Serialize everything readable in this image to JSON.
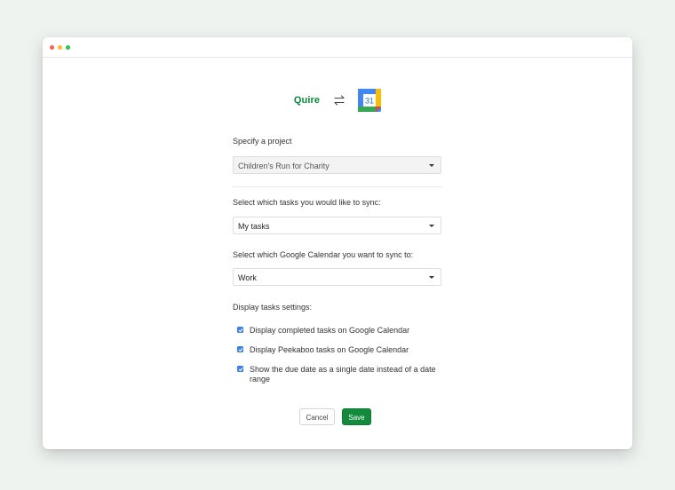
{
  "window": {
    "controls": [
      {
        "name": "close",
        "color": "#ff5f57"
      },
      {
        "name": "minimize",
        "color": "#febc2e"
      },
      {
        "name": "maximize",
        "color": "#28c840"
      }
    ]
  },
  "header": {
    "app_name": "Quire",
    "sync_icon": "swap-arrows-icon",
    "calendar_icon": "google-calendar-icon",
    "calendar_day": "31"
  },
  "form": {
    "project_label": "Specify a project",
    "project_value": "Children's Run for Charity",
    "tasks_label": "Select which tasks you would like to sync:",
    "tasks_value": "My tasks",
    "calendar_label": "Select which Google Calendar you want to sync to:",
    "calendar_value": "Work",
    "display_label": "Display tasks settings:",
    "options": [
      {
        "label": "Display completed tasks on Google Calendar",
        "checked": true
      },
      {
        "label": "Display Peekaboo tasks on Google Calendar",
        "checked": true
      },
      {
        "label": "Show the due date as a single date instead of a date range",
        "checked": true
      }
    ]
  },
  "actions": {
    "cancel_label": "Cancel",
    "save_label": "Save"
  },
  "colors": {
    "brand": "#0a8a3a",
    "save": "#138a3c",
    "checkbox": "#3b82e8",
    "background": "#eef3f0"
  }
}
